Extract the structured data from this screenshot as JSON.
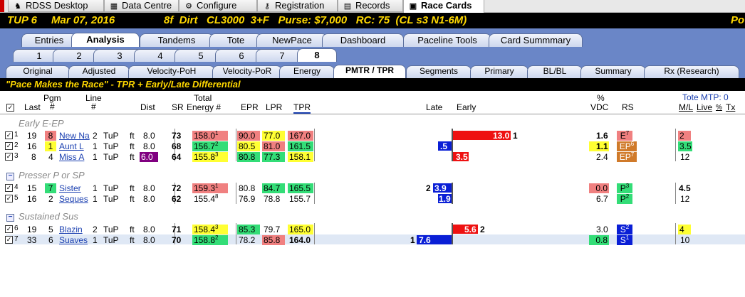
{
  "menu": {
    "tabs": [
      {
        "label": "RDSS Desktop",
        "icon": "horse-icon"
      },
      {
        "label": "Data Centre",
        "icon": "grid-icon"
      },
      {
        "label": "Configure",
        "icon": "gear-icon"
      },
      {
        "label": "Registration",
        "icon": "key-icon"
      },
      {
        "label": "Records",
        "icon": "document-icon"
      },
      {
        "label": "Race Cards",
        "icon": "card-icon"
      }
    ]
  },
  "race": {
    "track": "TUP 6",
    "date": "Mar 07, 2016",
    "conditions": "8f  Dirt   CL3000  3+F   Purse: $7,000   RC: 75  (CL s3 N1-6M)",
    "right": "Po"
  },
  "tabs_main": [
    "Entries",
    "Analysis",
    "Tandems",
    "Tote",
    "NewPace",
    "Dashboard",
    "Paceline Tools",
    "Card Summmary"
  ],
  "tabs_race": [
    "1",
    "2",
    "3",
    "4",
    "5",
    "6",
    "7",
    "8"
  ],
  "tabs_sub": [
    "Original",
    "Adjusted",
    "Velocity-PoH",
    "Velocity-PoR",
    "Energy",
    "PMTR / TPR",
    "Segments",
    "Primary",
    "BL/BL",
    "Summary",
    "Rx (Research)"
  ],
  "banner": "\"Pace Makes the Race\" - TPR + Early/Late Differential",
  "headers": {
    "last": "Last",
    "pgm": "Pgm",
    "pgm_hash": "#",
    "line": "Line",
    "line_hash": "#",
    "dist": "Dist",
    "sr": "SR",
    "total": "Total",
    "energy": "Energy #",
    "epr": "EPR",
    "lpr": "LPR",
    "tpr": "TPR",
    "late": "Late",
    "early": "Early",
    "pct": "%",
    "vdc": "VDC",
    "rs": "RS",
    "tote": "Tote MTP:  0",
    "ml": "M/L",
    "live": "Live",
    "pctcol": "%",
    "tx": "Tx"
  },
  "groups": [
    {
      "label": "Early E-EP",
      "rows": [
        {
          "n": "1",
          "last": "19",
          "pgm": "8",
          "name": "New Na",
          "line": "2",
          "surf": "TuP",
          "ft": "ft",
          "dist": "8.0",
          "sr": "73",
          "energy": "158.0",
          "erank": "1",
          "epr": "90.0",
          "lpr": "77.0",
          "tpr": "167.0",
          "late": "",
          "early": "13.0",
          "erank2": "1",
          "vdc": "1.6",
          "rs": "E",
          "rsn": "7",
          "ml": "2"
        },
        {
          "n": "2",
          "last": "16",
          "pgm": "1",
          "name": "Aunt L",
          "line": "1",
          "surf": "TuP",
          "ft": "ft",
          "dist": "8.0",
          "sr": "68",
          "energy": "156.7",
          "erank": "2",
          "epr": "80.5",
          "lpr": "81.0",
          "tpr": "161.5",
          "late": ".5",
          "early": "",
          "erank2": "",
          "vdc": "1.1",
          "rs": "EP",
          "rsn": "6",
          "ml": "3.5"
        },
        {
          "n": "3",
          "last": "8",
          "pgm": "4",
          "name": "Miss A",
          "line": "1",
          "surf": "TuP",
          "ft": "ft",
          "dist": "6.0",
          "sr": "64",
          "energy": "155.8",
          "erank": "3",
          "epr": "80.8",
          "lpr": "77.3",
          "tpr": "158.1",
          "late": "",
          "early": "3.5",
          "erank2": "",
          "vdc": "2.4",
          "rs": "EP",
          "rsn": "7",
          "ml": "12"
        }
      ]
    },
    {
      "label": "Presser P or SP",
      "rows": [
        {
          "n": "4",
          "last": "15",
          "pgm": "7",
          "name": "Sister",
          "line": "1",
          "surf": "TuP",
          "ft": "ft",
          "dist": "8.0",
          "sr": "72",
          "energy": "159.3",
          "erank": "1",
          "epr": "80.8",
          "lpr": "84.7",
          "tpr": "165.5",
          "late": "3.9",
          "laterank": "2",
          "early": "",
          "vdc": "0.0",
          "rs": "P",
          "rsn": "3",
          "ml": "4.5"
        },
        {
          "n": "5",
          "last": "16",
          "pgm": "2",
          "name": "Seques",
          "line": "1",
          "surf": "TuP",
          "ft": "ft",
          "dist": "8.0",
          "sr": "62",
          "energy": "155.4",
          "erank": "8",
          "epr": "76.9",
          "lpr": "78.8",
          "tpr": "155.7",
          "late": "1.9",
          "early": "",
          "vdc": "6.7",
          "rs": "P",
          "rsn": "2",
          "ml": "12"
        }
      ]
    },
    {
      "label": "Sustained Sus",
      "rows": [
        {
          "n": "6",
          "last": "19",
          "pgm": "5",
          "name": "Blazin",
          "line": "2",
          "surf": "TuP",
          "ft": "ft",
          "dist": "8.0",
          "sr": "71",
          "energy": "158.4",
          "erank": "3",
          "epr": "85.3",
          "lpr": "79.7",
          "tpr": "165.0",
          "late": "",
          "early": "5.6",
          "erank2": "2",
          "vdc": "3.0",
          "rs": "S",
          "rsn": "2",
          "ml": "4"
        },
        {
          "n": "7",
          "last": "33",
          "pgm": "6",
          "name": "Suaves",
          "line": "1",
          "surf": "TuP",
          "ft": "ft",
          "dist": "8.0",
          "sr": "70",
          "energy": "158.8",
          "erank": "2",
          "epr": "78.2",
          "lpr": "85.8",
          "tpr": "164.0",
          "late": "7.6",
          "laterank": "1",
          "early": "",
          "vdc": "0.8",
          "rs": "S",
          "rsn": "1",
          "ml": "10"
        }
      ]
    }
  ],
  "colors": {
    "red": "#f08080",
    "yellow": "#ffff33",
    "green": "#33dd77",
    "purple": "#800080",
    "blue": "#0a1fd6",
    "barRed": "#ee1111",
    "orange": "#d07a2a",
    "tabbar": "#6a86c7"
  }
}
